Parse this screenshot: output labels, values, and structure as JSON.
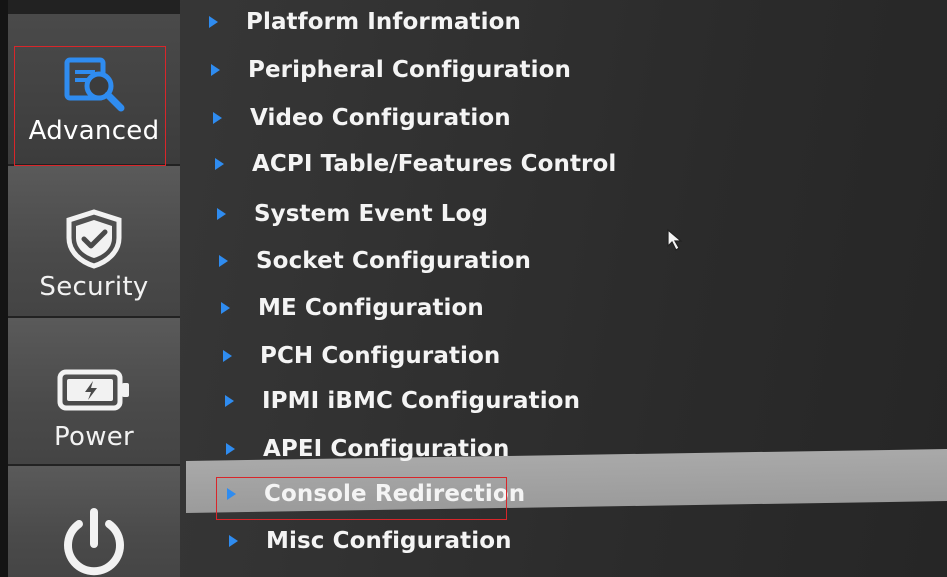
{
  "sidebar": {
    "items": [
      {
        "label": "Advanced",
        "icon": "advanced-icon",
        "active": true
      },
      {
        "label": "Security",
        "icon": "shield-check-icon",
        "active": false
      },
      {
        "label": "Power",
        "icon": "battery-icon",
        "active": false
      },
      {
        "label": "",
        "icon": "power-button-icon",
        "active": false
      }
    ]
  },
  "menu": {
    "items": [
      {
        "label": "Platform Information"
      },
      {
        "label": "Peripheral Configuration"
      },
      {
        "label": "Video Configuration"
      },
      {
        "label": "ACPI Table/Features Control"
      },
      {
        "label": "System Event Log"
      },
      {
        "label": "Socket Configuration"
      },
      {
        "label": "ME Configuration"
      },
      {
        "label": "PCH Configuration"
      },
      {
        "label": "IPMI iBMC Configuration"
      },
      {
        "label": "APEI Configuration"
      },
      {
        "label": "Console Redirection",
        "selected": true
      },
      {
        "label": "Misc Configuration"
      }
    ]
  },
  "colors": {
    "accent": "#2f8cf0",
    "highlight": "#d8262a",
    "selection_bar": "#a3a3a3",
    "text": "#f4f4f4"
  }
}
